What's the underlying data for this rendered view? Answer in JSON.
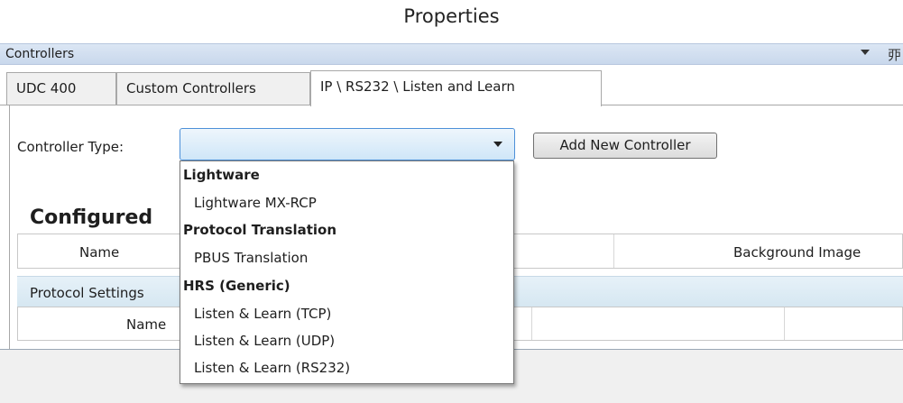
{
  "window": {
    "title": "Properties"
  },
  "panel": {
    "title": "Controllers",
    "dropdown_icon": "triangle-down",
    "pin_icon": "pin"
  },
  "tabs": [
    {
      "label": "UDC 400",
      "active": false
    },
    {
      "label": "Custom Controllers",
      "active": false
    },
    {
      "label": "IP \\ RS232  \\ Listen and Learn",
      "active": true
    }
  ],
  "controller_type": {
    "label": "Controller Type:",
    "value": ""
  },
  "add_button": {
    "label": "Add New Controller"
  },
  "configured": {
    "heading": "Configured"
  },
  "grid1": {
    "columns": [
      "Name",
      "Background Image"
    ]
  },
  "protocol_settings": {
    "label": "Protocol Settings"
  },
  "grid2": {
    "columns": [
      "Name"
    ]
  },
  "dropdown": {
    "groups": [
      {
        "label": "Lightware",
        "options": [
          "Lightware MX-RCP"
        ]
      },
      {
        "label": "Protocol Translation",
        "options": [
          "PBUS Translation"
        ]
      },
      {
        "label": "HRS (Generic)",
        "options": [
          "Listen & Learn (TCP)",
          "Listen & Learn (UDP)",
          "Listen & Learn (RS232)"
        ]
      }
    ]
  },
  "colors": {
    "header_bar": "#c9d8ec",
    "combo_border": "#4d90d8",
    "protocol_band": "#d4e6f1"
  }
}
